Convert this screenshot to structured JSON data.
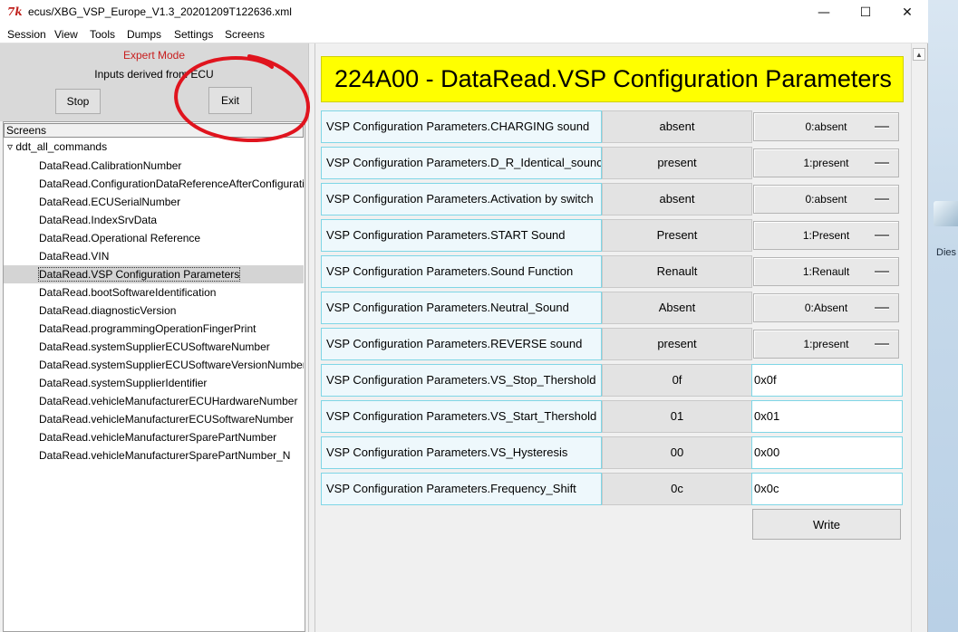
{
  "window": {
    "title": "ecus/XBG_VSP_Europe_V1.3_20201209T122636.xml",
    "app_icon_glyph": "7k",
    "controls": {
      "minimize": "—",
      "maximize": "☐",
      "close": "✕"
    }
  },
  "menu": [
    "Session",
    "View",
    "Tools",
    "Dumps",
    "Settings",
    "Screens"
  ],
  "left_panel": {
    "mode": "Expert Mode",
    "inputs_source": "Inputs derived from ECU",
    "stop_label": "Stop",
    "exit_label": "Exit",
    "tree_header": "Screens",
    "tree_root": "ddt_all_commands",
    "tree_items": [
      "DataRead.CalibrationNumber",
      "DataRead.ConfigurationDataReferenceAfterConfiguration",
      "DataRead.ECUSerialNumber",
      "DataRead.IndexSrvData",
      "DataRead.Operational Reference",
      "DataRead.VIN",
      "DataRead.VSP Configuration Parameters",
      "DataRead.bootSoftwareIdentification",
      "DataRead.diagnosticVersion",
      "DataRead.programmingOperationFingerPrint",
      "DataRead.systemSupplierECUSoftwareNumber",
      "DataRead.systemSupplierECUSoftwareVersionNumber",
      "DataRead.systemSupplierIdentifier",
      "DataRead.vehicleManufacturerECUHardwareNumber",
      "DataRead.vehicleManufacturerECUSoftwareNumber",
      "DataRead.vehicleManufacturerSparePartNumber",
      "DataRead.vehicleManufacturerSparePartNumber_N"
    ],
    "selected_index": 6
  },
  "main": {
    "header": "224A00 - DataRead.VSP Configuration Parameters",
    "params": [
      {
        "label": "VSP Configuration Parameters.CHARGING sound",
        "value": "absent",
        "option": "0:absent"
      },
      {
        "label": "VSP Configuration Parameters.D_R_Identical_sound",
        "value": "present",
        "option": "1:present"
      },
      {
        "label": "VSP Configuration Parameters.Activation by switch",
        "value": "absent",
        "option": "0:absent"
      },
      {
        "label": "VSP Configuration Parameters.START Sound",
        "value": "Present",
        "option": "1:Present"
      },
      {
        "label": "VSP Configuration Parameters.Sound Function",
        "value": "Renault",
        "option": "1:Renault"
      },
      {
        "label": "VSP Configuration Parameters.Neutral_Sound",
        "value": "Absent",
        "option": "0:Absent"
      },
      {
        "label": "VSP Configuration Parameters.REVERSE sound",
        "value": "present",
        "option": "1:present"
      },
      {
        "label": "VSP Configuration Parameters.VS_Stop_Thershold",
        "value": "0f",
        "input": "0x0f"
      },
      {
        "label": "VSP Configuration Parameters.VS_Start_Thershold",
        "value": "01",
        "input": "0x01"
      },
      {
        "label": "VSP Configuration Parameters.VS_Hysteresis",
        "value": "00",
        "input": "0x00"
      },
      {
        "label": "VSP Configuration Parameters.Frequency_Shift",
        "value": "0c",
        "input": "0x0c"
      }
    ],
    "write_label": "Write"
  },
  "desktop": {
    "icon_label": "Dies"
  },
  "colors": {
    "header_bg": "#ffff00",
    "label_border": "#7fd6e6",
    "expert_mode": "#c81e1e",
    "annotation": "#e0141e"
  }
}
